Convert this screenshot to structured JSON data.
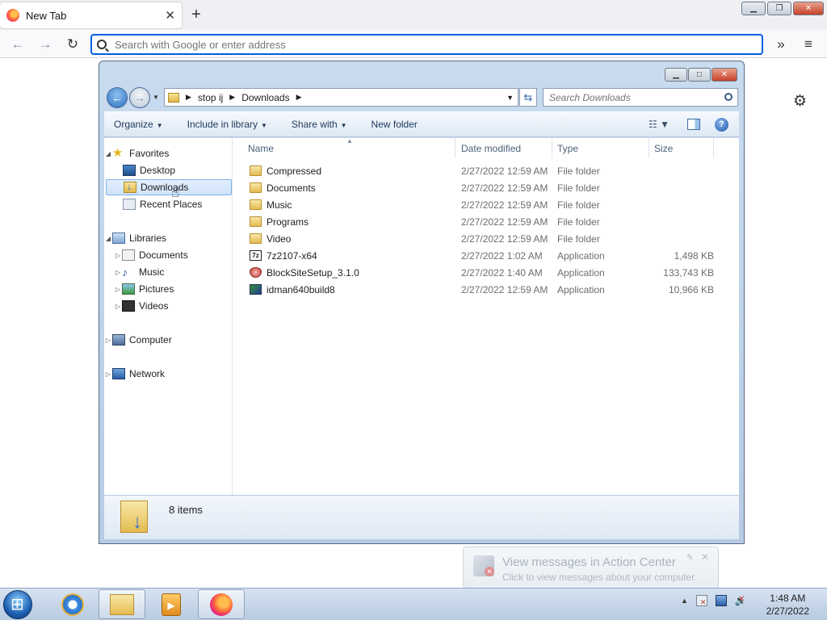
{
  "browser": {
    "tab_title": "New Tab",
    "url_placeholder": "Search with Google or enter address"
  },
  "explorer": {
    "breadcrumb": [
      "stop ij",
      "Downloads"
    ],
    "search_placeholder": "Search Downloads",
    "toolbar": {
      "organize": "Organize",
      "include_in_library": "Include in library",
      "share_with": "Share with",
      "new_folder": "New folder"
    },
    "nav": {
      "favorites": "Favorites",
      "desktop": "Desktop",
      "downloads": "Downloads",
      "recent_places": "Recent Places",
      "libraries": "Libraries",
      "documents": "Documents",
      "music": "Music",
      "pictures": "Pictures",
      "videos": "Videos",
      "computer": "Computer",
      "network": "Network"
    },
    "columns": {
      "name": "Name",
      "date_modified": "Date modified",
      "type": "Type",
      "size": "Size"
    },
    "files": [
      {
        "name": "Compressed",
        "date": "2/27/2022 12:59 AM",
        "type": "File folder",
        "size": "",
        "icon": "folder-icon"
      },
      {
        "name": "Documents",
        "date": "2/27/2022 12:59 AM",
        "type": "File folder",
        "size": "",
        "icon": "folder-icon"
      },
      {
        "name": "Music",
        "date": "2/27/2022 12:59 AM",
        "type": "File folder",
        "size": "",
        "icon": "folder-icon"
      },
      {
        "name": "Programs",
        "date": "2/27/2022 12:59 AM",
        "type": "File folder",
        "size": "",
        "icon": "folder-icon"
      },
      {
        "name": "Video",
        "date": "2/27/2022 12:59 AM",
        "type": "File folder",
        "size": "",
        "icon": "folder-icon"
      },
      {
        "name": "7z2107-x64",
        "date": "2/27/2022 1:02 AM",
        "type": "Application",
        "size": "1,498 KB",
        "icon": "7zip-icon"
      },
      {
        "name": "BlockSiteSetup_3.1.0",
        "date": "2/27/2022 1:40 AM",
        "type": "Application",
        "size": "133,743 KB",
        "icon": "shield-app-icon"
      },
      {
        "name": "idman640build8",
        "date": "2/27/2022 12:59 AM",
        "type": "Application",
        "size": "10,966 KB",
        "icon": "idm-icon"
      }
    ],
    "status": "8 items"
  },
  "action_center": {
    "title": "View messages in Action Center",
    "subtitle": "Click to view messages about your computer."
  },
  "taskbar": {
    "time": "1:48 AM",
    "date": "2/27/2022"
  }
}
